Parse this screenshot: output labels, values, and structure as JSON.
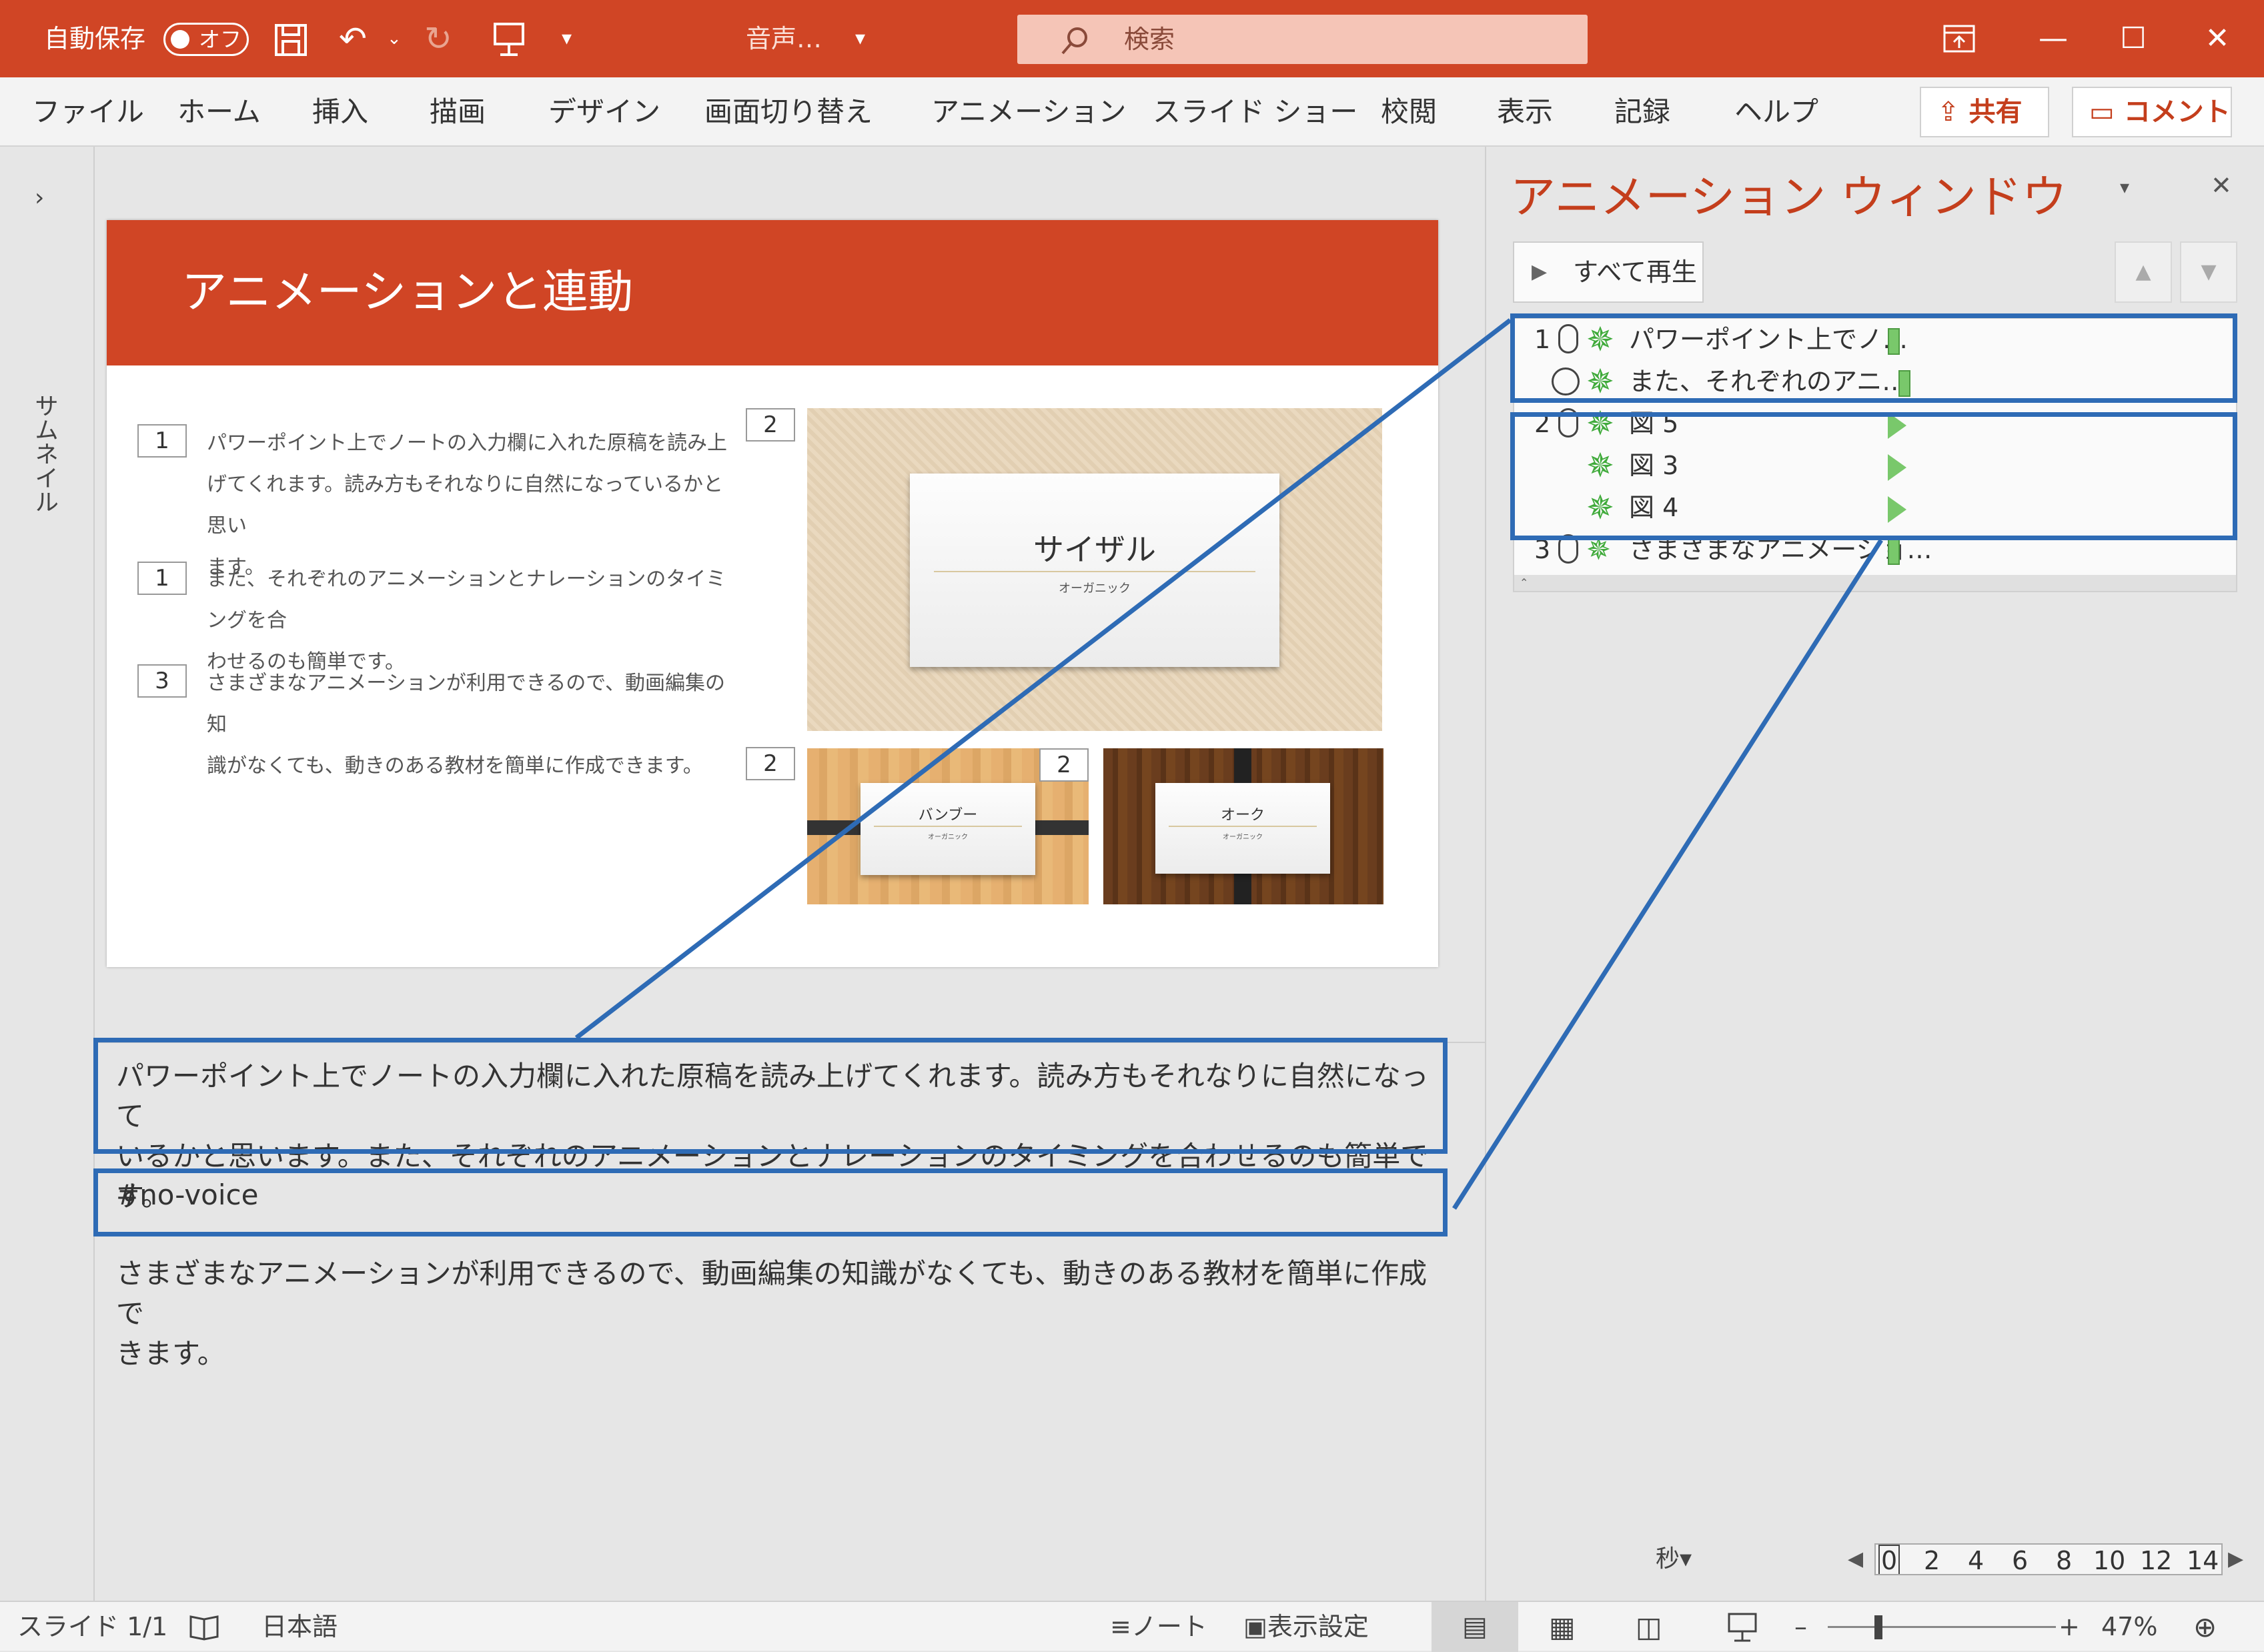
{
  "titlebar": {
    "autosave_label": "自動保存",
    "autosave_state": "オフ",
    "doc_name": "音声…",
    "search_placeholder": "検索"
  },
  "ribbon": {
    "tabs": [
      "ファイル",
      "ホーム",
      "挿入",
      "描画",
      "デザイン",
      "画面切り替え",
      "アニメーション",
      "スライド ショー",
      "校閲",
      "表示",
      "記録",
      "ヘルプ"
    ],
    "share_label": "共有",
    "comment_label": "コメント"
  },
  "thumbnail_label": "サムネイル",
  "slide": {
    "title": "アニメーションと連動",
    "bullets": [
      {
        "num": "1",
        "lines": [
          "パワーポイント上でノートの入力欄に入れた原稿を読み上",
          "げてくれます。読み方もそれなりに自然になっているかと思い",
          "ます。"
        ]
      },
      {
        "num": "1",
        "lines": [
          "また、それぞれのアニメーションとナレーションのタイミングを合",
          "わせるのも簡単です。"
        ]
      },
      {
        "num": "3",
        "lines": [
          "さまざまなアニメーションが利用できるので、動画編集の知",
          "識がなくても、動きのある教材を簡単に作成できます。"
        ]
      }
    ],
    "photo_markers": [
      "2",
      "2",
      "2"
    ],
    "photos": [
      {
        "title": "サイザル",
        "subtitle": "オーガニック"
      },
      {
        "title": "バンブー",
        "subtitle": "オーガニック"
      },
      {
        "title": "オーク",
        "subtitle": "オーガニック"
      }
    ]
  },
  "notes": {
    "paragraph1_line1": "パワーポイント上でノートの入力欄に入れた原稿を読み上げてくれます。読み方もそれなりに自然になって",
    "paragraph1_line2": "いるかと思います。また、それぞれのアニメーションとナレーションのタイミングを合わせるのも簡単です。",
    "tag": "#no-voice",
    "paragraph2_line1": "さまざまなアニメーションが利用できるので、動画編集の知識がなくても、動きのある教材を簡単に作成で",
    "paragraph2_line2": "きます。"
  },
  "anim_pane": {
    "title": "アニメーション ウィンドウ",
    "play_all": "すべて再生",
    "items": [
      {
        "num": "1",
        "trigger": "click",
        "label": "パワーポイント上でノ…",
        "marker": "bar"
      },
      {
        "num": "",
        "trigger": "after",
        "label": "また、それぞれのアニ…",
        "marker": "bar"
      },
      {
        "num": "2",
        "trigger": "click",
        "label": "図 5",
        "marker": "triangle"
      },
      {
        "num": "",
        "trigger": "with",
        "label": "図 3",
        "marker": "triangle"
      },
      {
        "num": "",
        "trigger": "with",
        "label": "図 4",
        "marker": "triangle"
      },
      {
        "num": "3",
        "trigger": "click",
        "label": "さまざまなアニメーショ…",
        "marker": "bar"
      }
    ],
    "timeline_unit": "秒",
    "timeline_ticks": [
      "0",
      "2",
      "4",
      "6",
      "8",
      "10",
      "12",
      "14"
    ]
  },
  "statusbar": {
    "slide_info": "スライド 1/1",
    "language": "日本語",
    "notes_label": "ノート",
    "display_settings": "表示設定",
    "zoom": "47%"
  },
  "colors": {
    "accent": "#d04525",
    "callout": "#2e6bb5",
    "anim_green": "#79c86b"
  }
}
